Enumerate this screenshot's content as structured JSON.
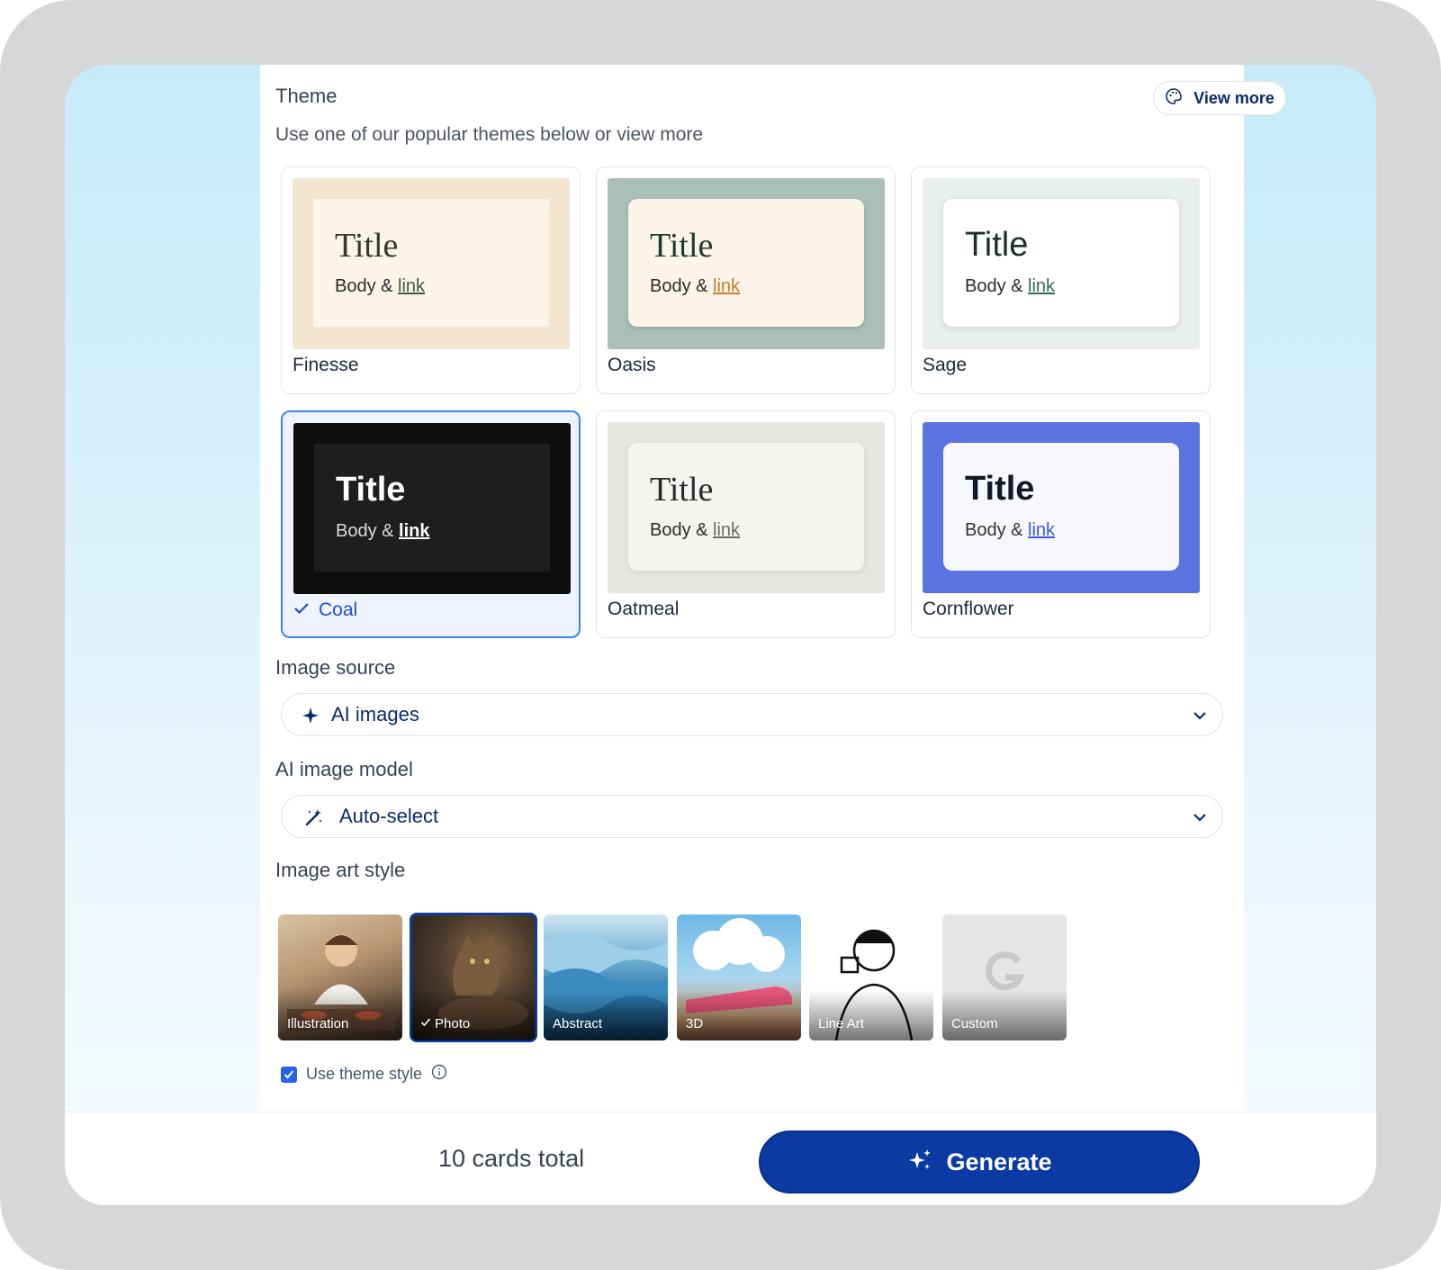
{
  "theme": {
    "label": "Theme",
    "hint": "Use one of our popular themes below or view more",
    "view_more": "View more",
    "cards": [
      {
        "name": "Finesse",
        "title": "Title",
        "body": "Body &",
        "link": "link",
        "selected": false
      },
      {
        "name": "Oasis",
        "title": "Title",
        "body": "Body &",
        "link": "link",
        "selected": false
      },
      {
        "name": "Sage",
        "title": "Title",
        "body": "Body &",
        "link": "link",
        "selected": false
      },
      {
        "name": "Coal",
        "title": "Title",
        "body": "Body &",
        "link": "link",
        "selected": true
      },
      {
        "name": "Oatmeal",
        "title": "Title",
        "body": "Body &",
        "link": "link",
        "selected": false
      },
      {
        "name": "Cornflower",
        "title": "Title",
        "body": "Body &",
        "link": "link",
        "selected": false
      }
    ]
  },
  "image_source": {
    "label": "Image source",
    "value": "AI images",
    "icon": "sparkle-icon"
  },
  "ai_model": {
    "label": "AI image model",
    "value": "Auto-select",
    "icon": "magic-wand-icon"
  },
  "art_style": {
    "label": "Image art style",
    "styles": [
      {
        "name": "Illustration",
        "selected": false
      },
      {
        "name": "Photo",
        "selected": true
      },
      {
        "name": "Abstract",
        "selected": false
      },
      {
        "name": "3D",
        "selected": false
      },
      {
        "name": "Line Art",
        "selected": false
      },
      {
        "name": "Custom",
        "selected": false
      }
    ],
    "use_theme_style": "Use theme style",
    "use_theme_style_checked": true
  },
  "footer": {
    "cards_total": "10 cards total",
    "generate": "Generate"
  },
  "colors": {
    "accent": "#0b3aa3",
    "selected_border": "#3b82f6",
    "cornflower": "#5b73e0"
  }
}
